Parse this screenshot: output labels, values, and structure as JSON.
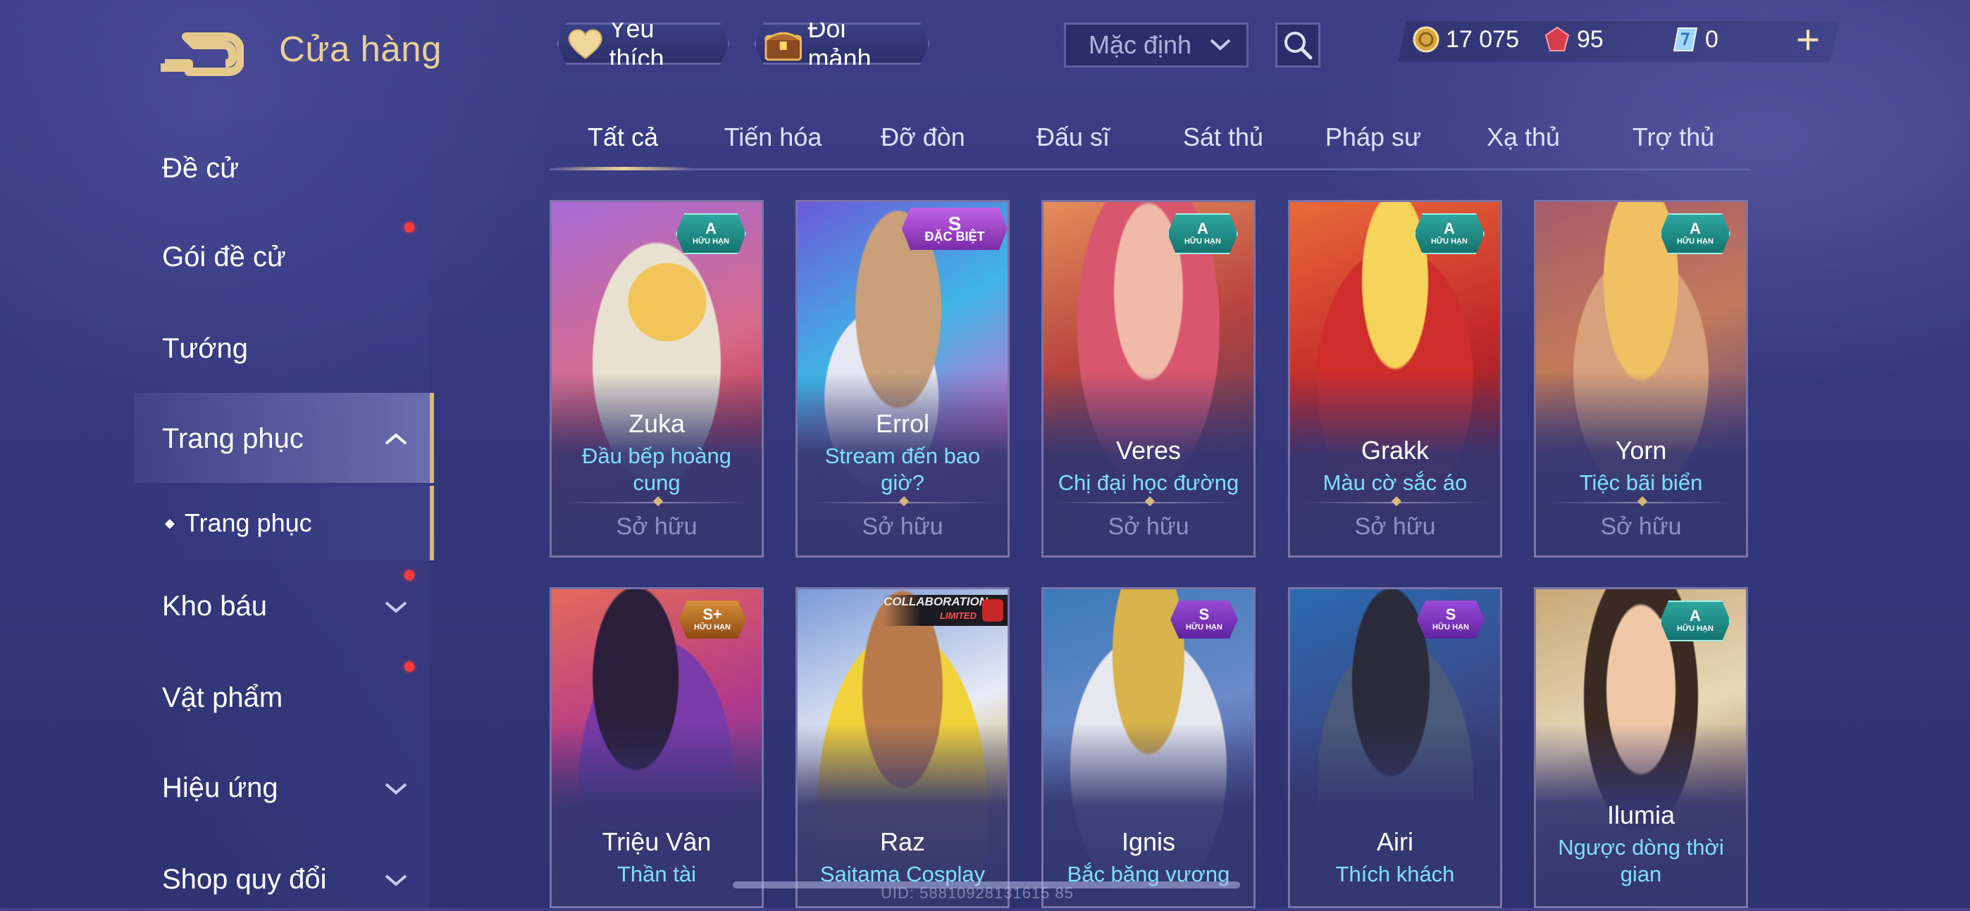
{
  "header": {
    "title": "Cửa hàng",
    "favorite_label": "Yêu thích",
    "fragment_label": "Đổi mảnh",
    "sort_value": "Mặc định"
  },
  "currency": {
    "gold": "17 075",
    "voucher": "95",
    "gem": "0"
  },
  "sidebar": {
    "items": [
      {
        "label": "Đề cử"
      },
      {
        "label": "Gói đề cử"
      },
      {
        "label": "Tướng"
      },
      {
        "label": "Trang phục"
      },
      {
        "label": "Trang phục"
      },
      {
        "label": "Kho báu"
      },
      {
        "label": "Vật phẩm"
      },
      {
        "label": "Hiệu ứng"
      },
      {
        "label": "Shop quy đổi"
      }
    ]
  },
  "tabs": [
    {
      "label": "Tất cả"
    },
    {
      "label": "Tiến hóa"
    },
    {
      "label": "Đỡ đòn"
    },
    {
      "label": "Đấu sĩ"
    },
    {
      "label": "Sát thủ"
    },
    {
      "label": "Pháp sư"
    },
    {
      "label": "Xạ thủ"
    },
    {
      "label": "Trợ thủ"
    }
  ],
  "cards": [
    {
      "hero": "Zuka",
      "skin": "Đầu bếp hoàng cung",
      "status": "Sở hữu",
      "grade": "A",
      "tag": "HỮU HẠN"
    },
    {
      "hero": "Errol",
      "skin": "Stream đến bao giờ?",
      "status": "Sở hữu",
      "grade": "S",
      "tag": "ĐẶC BIỆT"
    },
    {
      "hero": "Veres",
      "skin": "Chị đại học đường",
      "status": "Sở hữu",
      "grade": "A",
      "tag": "HỮU HẠN"
    },
    {
      "hero": "Grakk",
      "skin": "Màu cờ sắc áo",
      "status": "Sở hữu",
      "grade": "A",
      "tag": "HỮU HẠN"
    },
    {
      "hero": "Yorn",
      "skin": "Tiệc bãi biển",
      "status": "Sở hữu",
      "grade": "A",
      "tag": "HỮU HẠN"
    },
    {
      "hero": "Triệu Vân",
      "skin": "Thần tài",
      "grade": "S+",
      "tag": "HỮU HẠN"
    },
    {
      "hero": "Raz",
      "skin": "Saitama Cosplay",
      "collab_top": "COLLABORATION",
      "collab_bottom": "LIMITED"
    },
    {
      "hero": "Ignis",
      "skin": "Bắc băng vương",
      "grade": "S",
      "tag": "HỮU HẠN"
    },
    {
      "hero": "Airi",
      "skin": "Thích khách",
      "grade": "S",
      "tag": "HỮU HẠN"
    },
    {
      "hero": "Ilumia",
      "skin": "Ngược dòng thời gian",
      "grade": "A",
      "tag": "HỮU HẠN"
    }
  ],
  "footer": {
    "uid": "UID: 58810928131615 85"
  },
  "colors": {
    "accent_gold": "#e9cf97",
    "skin_name": "#7ee0ff",
    "owned_text": "#8e92c2",
    "notification": "#ff3b3b"
  }
}
